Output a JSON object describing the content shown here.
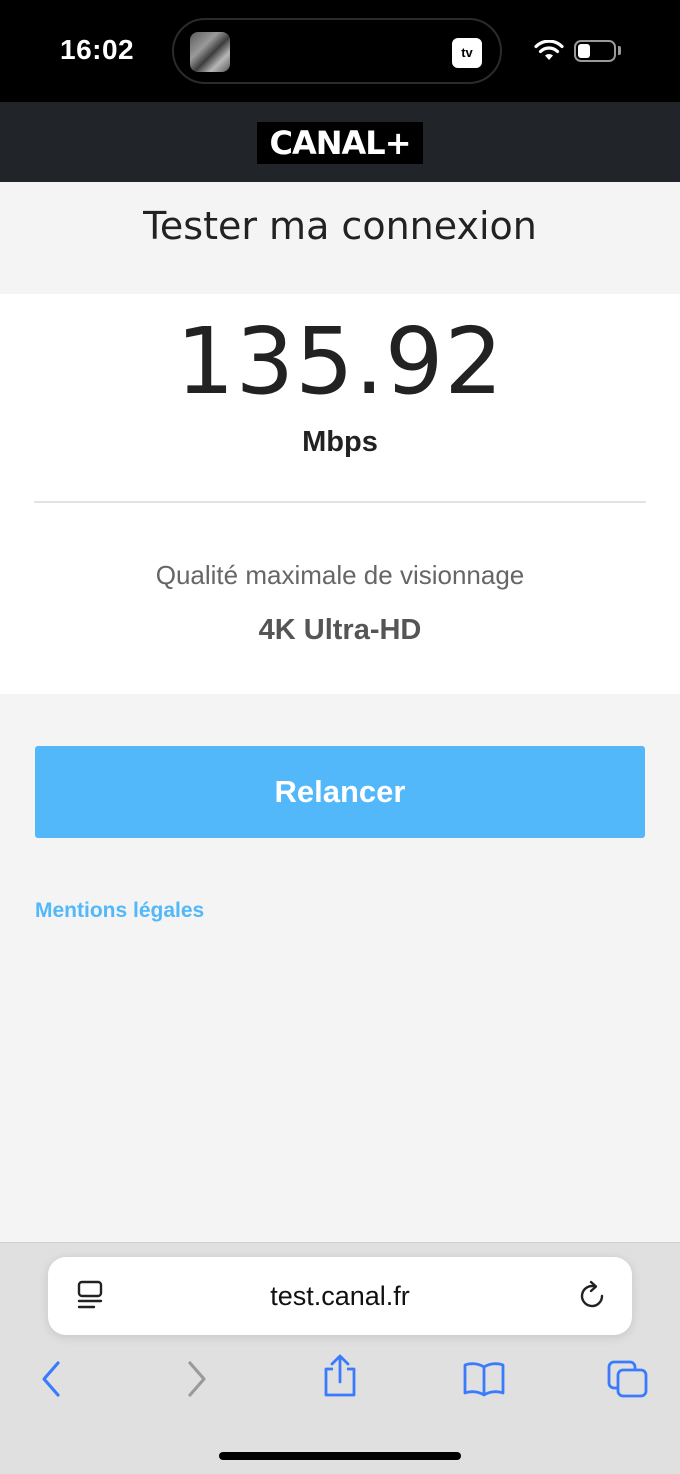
{
  "status_bar": {
    "time": "16:02",
    "island_badge": "tv",
    "icons": [
      "wifi-icon",
      "battery-icon",
      "apple-tv-icon"
    ]
  },
  "header": {
    "logo_text": "CANAL+"
  },
  "main": {
    "title": "Tester ma connexion",
    "speed_value": "135.92",
    "speed_unit": "Mbps",
    "quality_label": "Qualité maximale de visionnage",
    "quality_value": "4K Ultra-HD",
    "relaunch_label": "Relancer",
    "legal_link": "Mentions légales"
  },
  "browser": {
    "url": "test.canal.fr",
    "icons": [
      "reader-icon",
      "reload-icon",
      "back-icon",
      "forward-icon",
      "share-icon",
      "bookmarks-icon",
      "tabs-icon"
    ]
  },
  "colors": {
    "accent": "#52b8fa",
    "header_bg": "#212529",
    "page_bg": "#f4f4f4",
    "status_bar": "#000000",
    "ios_blue": "#3a7bfd"
  }
}
